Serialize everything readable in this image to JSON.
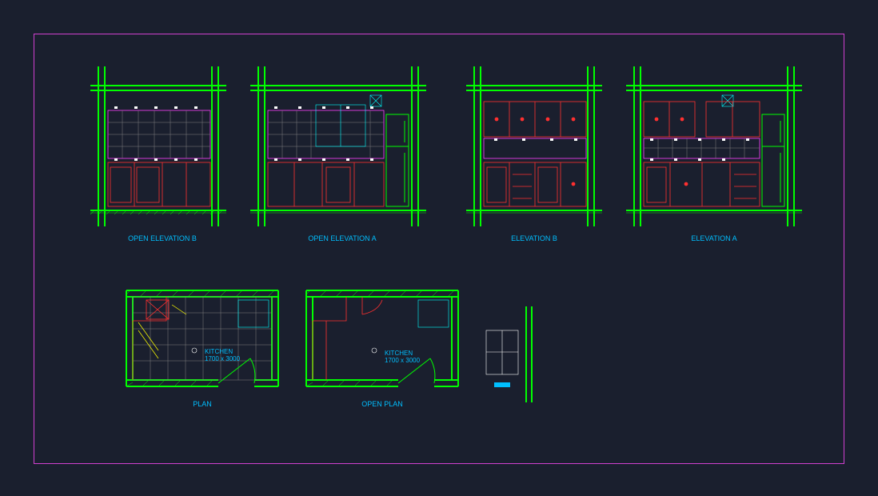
{
  "frame": {
    "border_color": "#d040d0",
    "background": "#1a1f2e"
  },
  "drawings": {
    "elevations": [
      {
        "id": "open-elev-b",
        "label": "OPEN ELEVATION B"
      },
      {
        "id": "open-elev-a",
        "label": "OPEN ELEVATION A"
      },
      {
        "id": "elev-b",
        "label": "ELEVATION B"
      },
      {
        "id": "elev-a",
        "label": "ELEVATION A"
      }
    ],
    "plans": [
      {
        "id": "plan",
        "label": "PLAN",
        "room": {
          "name": "KITCHEN",
          "dims": "1700 x 3000"
        }
      },
      {
        "id": "open-plan",
        "label": "OPEN PLAN",
        "room": {
          "name": "KITCHEN",
          "dims": "1700 x 3000"
        }
      }
    ]
  },
  "layers": {
    "wall": "#00ff00",
    "cabinet": "#ff3030",
    "outline": "#00ffff",
    "grid": "#808080",
    "tile": "#ff40ff",
    "marker": "#ffffff",
    "accent": "#ffff00",
    "label": "#00bfff"
  },
  "icons": {
    "section_arrow": "▼",
    "target": "◎"
  }
}
